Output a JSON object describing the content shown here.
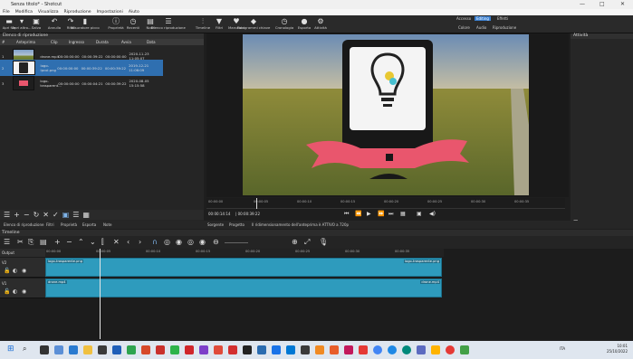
{
  "window": {
    "title": "Senza titolo* - Shotcut"
  },
  "menu": [
    "File",
    "Modifica",
    "Visualizza",
    "Riproduzione",
    "Impostazioni",
    "Aiuto"
  ],
  "toolbar": [
    {
      "label": "Apri file",
      "icon": "folder-open-icon",
      "glyph": "▬"
    },
    {
      "label": "Apri altro...",
      "icon": "open-other-icon",
      "glyph": "▾"
    },
    {
      "label": "Salva",
      "icon": "save-icon",
      "glyph": "▣"
    },
    {
      "label": "Annulla",
      "icon": "undo-icon",
      "glyph": "↶"
    },
    {
      "label": "Rifai",
      "icon": "redo-icon",
      "glyph": "↷"
    },
    {
      "label": "Misuratore picco",
      "icon": "peak-meter-icon",
      "glyph": "▮"
    },
    {
      "label": "Proprietà",
      "icon": "properties-icon",
      "glyph": "ⓘ"
    },
    {
      "label": "Recenti",
      "icon": "recent-icon",
      "glyph": "◷"
    },
    {
      "label": "Note",
      "icon": "notes-icon",
      "glyph": "▤"
    },
    {
      "label": "Elenco riproduzione",
      "icon": "playlist-icon",
      "glyph": "☰"
    },
    {
      "label": "Timeline",
      "icon": "timeline-icon",
      "glyph": "⫶"
    },
    {
      "label": "Filtri",
      "icon": "filters-icon",
      "glyph": "▼"
    },
    {
      "label": "Marcatori",
      "icon": "markers-icon",
      "glyph": "♥"
    },
    {
      "label": "Fotogrammi chiave",
      "icon": "keyframes-icon",
      "glyph": "◆"
    },
    {
      "label": "Cronologia",
      "icon": "history-icon",
      "glyph": "◷"
    },
    {
      "label": "Esporta",
      "icon": "export-icon",
      "glyph": "●"
    },
    {
      "label": "Attività",
      "icon": "jobs-icon",
      "glyph": "⚙"
    }
  ],
  "workspaces": {
    "row1": [
      "Accesso",
      "Editing",
      "Effetti"
    ],
    "row2": [
      "Colore",
      "Audio",
      "Riproduzione"
    ],
    "active": "Editing"
  },
  "playlist": {
    "title": "Elenco di riproduzione",
    "columns": [
      "#",
      "Anteprima",
      "Clip",
      "Ingresso",
      "Durata",
      "Avvia",
      "Data"
    ],
    "rows": [
      {
        "n": "1",
        "clip": "drone.mp4",
        "in": "00:00:00:00",
        "dur": "00:00:39:22",
        "start": "00:00:00:00",
        "date": "2020-11-23 11:05:07"
      },
      {
        "n": "2",
        "clip": "logo-lpcol.png",
        "in": "00:00:00:00",
        "dur": "00:00:39:22",
        "start": "00:00:39:22",
        "date": "2019-12-21 11:06:09"
      },
      {
        "n": "3",
        "clip": "logo-trasparent...",
        "in": "00:00:00:00",
        "dur": "00:00:04:21",
        "start": "00:00:39:22",
        "date": "2020-08-05 15:15:58"
      }
    ]
  },
  "bottom_tabs": [
    "Elenco di riproduzione",
    "Filtri",
    "Proprietà",
    "Esporta",
    "Note"
  ],
  "activity": {
    "title": "Attività",
    "pause": "Pausa"
  },
  "viewer": {
    "ruler": [
      "00:00:00",
      "00:00:05",
      "00:00:10",
      "00:00:15",
      "00:00:20",
      "00:00:25",
      "00:00:30",
      "00:00:35"
    ],
    "current_time": "00:00:14:14",
    "total_time": "| 00:00:39:22",
    "source_tab": "Sorgente",
    "project_tab": "Progetto",
    "status": "Il ridimensionamento dell'anteprima è ATTIVO a 720p"
  },
  "timeline": {
    "title": "Timeline",
    "output": "Output",
    "tracks": [
      {
        "name": "V2"
      },
      {
        "name": "V1"
      }
    ],
    "ruler": [
      "00:00:00",
      "00:00:05",
      "00:00:10",
      "00:00:15",
      "00:00:20",
      "00:00:25",
      "00:00:30",
      "00:00:35"
    ],
    "v2_clip_start": "logo-trasparente.png",
    "v2_clip_end": "logo-trasparente.png",
    "v1_clip_start": "drone.mp4",
    "v1_clip_end": "drone.mp4"
  },
  "taskbar": {
    "time": "10:01",
    "date": "25/10/2022",
    "lang": "ITA"
  },
  "colors": {
    "accent": "#2f6fb0",
    "clip": "#2e9bbd",
    "ribbon": "#e9566d",
    "taskbar": "#dfe6ef"
  }
}
